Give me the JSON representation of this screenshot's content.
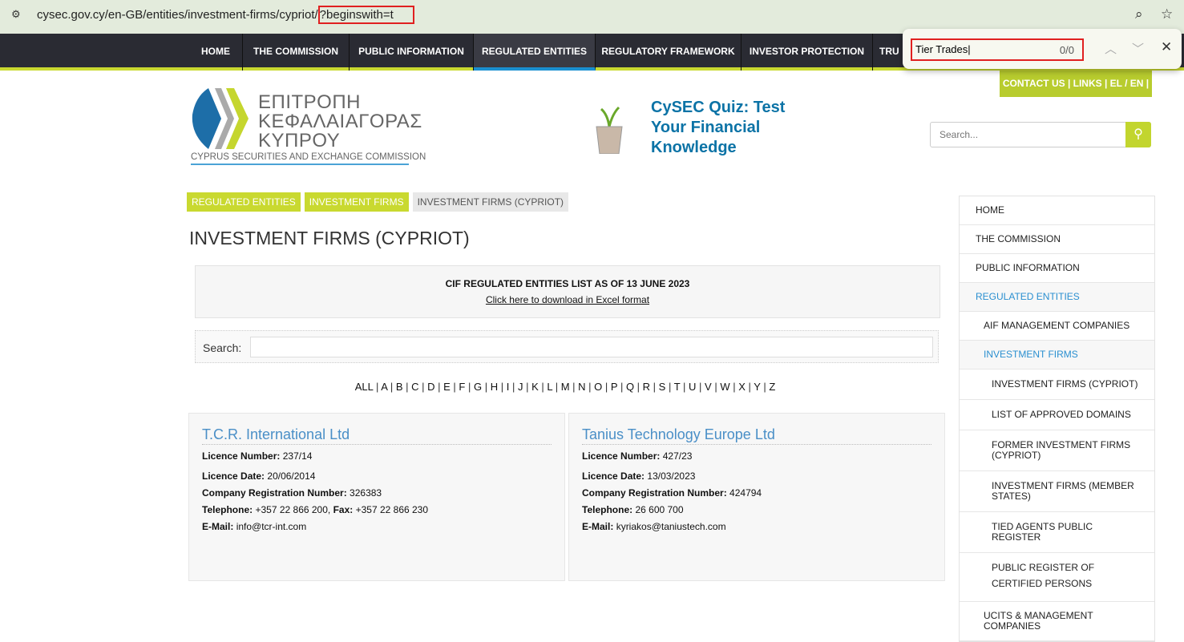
{
  "browser": {
    "url": "cysec.gov.cy/en-GB/entities/investment-firms/cypriot/",
    "url_query": "?beginswith=t"
  },
  "nav": [
    "HOME",
    "THE COMMISSION",
    "PUBLIC INFORMATION",
    "REGULATED ENTITIES",
    "REGULATORY FRAMEWORK",
    "INVESTOR PROTECTION",
    "TRU"
  ],
  "find": {
    "query": "Tier Trades",
    "count": "0/0"
  },
  "contact": "CONTACT US  |  LINKS  |   EL / EN |",
  "logo": {
    "greek": [
      "ΕΠΙΤΡΟΠΗ",
      "ΚΕΦΑΛΑΙΑΓΟΡΑΣ",
      "ΚΥΠΡΟΥ"
    ],
    "english": "CYPRUS SECURITIES AND EXCHANGE COMMISSION"
  },
  "quiz": "CySEC Quiz: Test Your Financial Knowledge",
  "search": {
    "placeholder": "Search..."
  },
  "breadcrumbs": [
    "REGULATED ENTITIES",
    "INVESTMENT FIRMS",
    "INVESTMENT FIRMS (CYPRIOT)"
  ],
  "title": "INVESTMENT FIRMS (CYPRIOT)",
  "cif": {
    "heading": "CIF REGULATED ENTITIES LIST AS OF 13 JUNE 2023",
    "link": "Click here to download in Excel format"
  },
  "filter": {
    "label": "Search:"
  },
  "alphabet": [
    "ALL",
    "A",
    "B",
    "C",
    "D",
    "E",
    "F",
    "G",
    "H",
    "I",
    "J",
    "K",
    "L",
    "M",
    "N",
    "O",
    "P",
    "Q",
    "R",
    "S",
    "T",
    "U",
    "V",
    "W",
    "X",
    "Y",
    "Z"
  ],
  "firms": [
    {
      "name": "T.C.R. International Ltd",
      "licence_number": "237/14",
      "licence_date": "20/06/2014",
      "reg_number": "326383",
      "telephone": "+357 22 866 200",
      "fax": "+357 22 866 230",
      "email": "info@tcr-int.com"
    },
    {
      "name": "Tanius Technology Europe Ltd",
      "licence_number": "427/23",
      "licence_date": "13/03/2023",
      "reg_number": "424794",
      "telephone": "26 600 700",
      "fax": null,
      "email": "kyriakos@taniustech.com"
    }
  ],
  "labels": {
    "licence_number": "Licence Number",
    "licence_date": "Licence Date",
    "reg_number": "Company Registration Number",
    "telephone": "Telephone",
    "fax": "Fax",
    "email": "E-Mail"
  },
  "sidebar": [
    "HOME",
    "THE COMMISSION",
    "PUBLIC INFORMATION",
    "REGULATED ENTITIES",
    "AIF MANAGEMENT COMPANIES",
    "INVESTMENT FIRMS",
    "INVESTMENT FIRMS (CYPRIOT)",
    "LIST OF APPROVED DOMAINS",
    "FORMER INVESTMENT FIRMS (CYPRIOT)",
    "INVESTMENT FIRMS (MEMBER STATES)",
    "TIED AGENTS PUBLIC REGISTER",
    "PUBLIC REGISTER OF CERTIFIED PERSONS",
    "UCITS & MANAGEMENT COMPANIES"
  ]
}
